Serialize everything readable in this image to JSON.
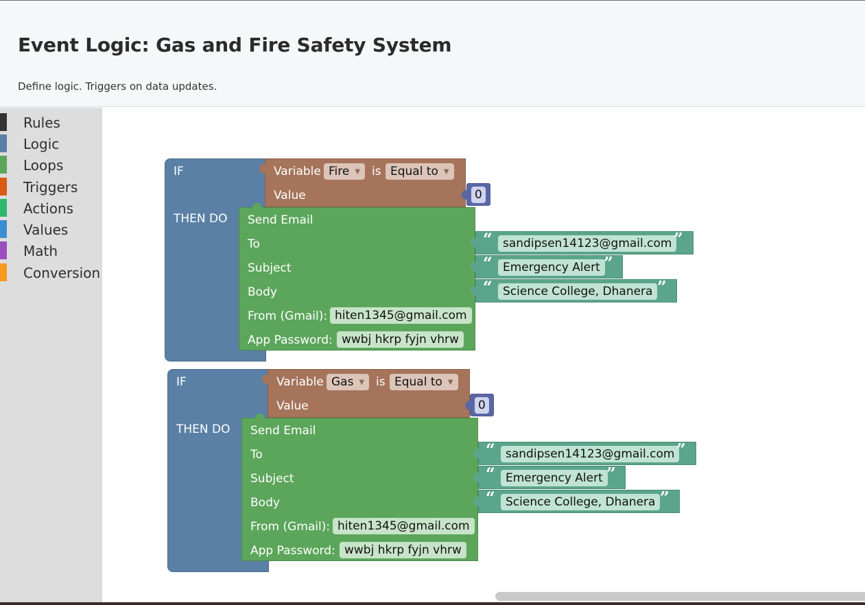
{
  "header": {
    "title": "Event Logic: Gas and Fire Safety System",
    "subtitle": "Define logic. Triggers on data updates."
  },
  "toolbox": {
    "categories": [
      {
        "label": "Rules",
        "color": "#333333"
      },
      {
        "label": "Logic",
        "color": "#5b80a5"
      },
      {
        "label": "Loops",
        "color": "#5ca65c"
      },
      {
        "label": "Triggers",
        "color": "#d95b14"
      },
      {
        "label": "Actions",
        "color": "#2eb86e"
      },
      {
        "label": "Values",
        "color": "#3a8dd1"
      },
      {
        "label": "Math",
        "color": "#9b4fbe"
      },
      {
        "label": "Conversion",
        "color": "#f49a1c"
      }
    ]
  },
  "rules": [
    {
      "if_label": "IF",
      "then_label": "THEN DO",
      "condition": {
        "variable_label": "Variable",
        "variable": "Fire",
        "is_label": "is",
        "operator": "Equal to",
        "value_label": "Value",
        "value": "0"
      },
      "action": {
        "title": "Send Email",
        "to_label": "To",
        "to": "sandipsen14123@gmail.com",
        "subject_label": "Subject",
        "subject": "Emergency Alert",
        "body_label": "Body",
        "body": "Science College, Dhanera",
        "from_label": "From (Gmail):",
        "from": "hiten1345@gmail.com",
        "password_label": "App Password:",
        "password": "wwbj hkrp fyjn vhrw"
      }
    },
    {
      "if_label": "IF",
      "then_label": "THEN DO",
      "condition": {
        "variable_label": "Variable",
        "variable": "Gas",
        "is_label": "is",
        "operator": "Equal to",
        "value_label": "Value",
        "value": "0"
      },
      "action": {
        "title": "Send Email",
        "to_label": "To",
        "to": "sandipsen14123@gmail.com",
        "subject_label": "Subject",
        "subject": "Emergency Alert",
        "body_label": "Body",
        "body": "Science College, Dhanera",
        "from_label": "From (Gmail):",
        "from": "hiten1345@gmail.com",
        "password_label": "App Password:",
        "password": "wwbj hkrp fyjn vhrw"
      }
    }
  ],
  "quotes": {
    "open": "“",
    "close": "”"
  }
}
